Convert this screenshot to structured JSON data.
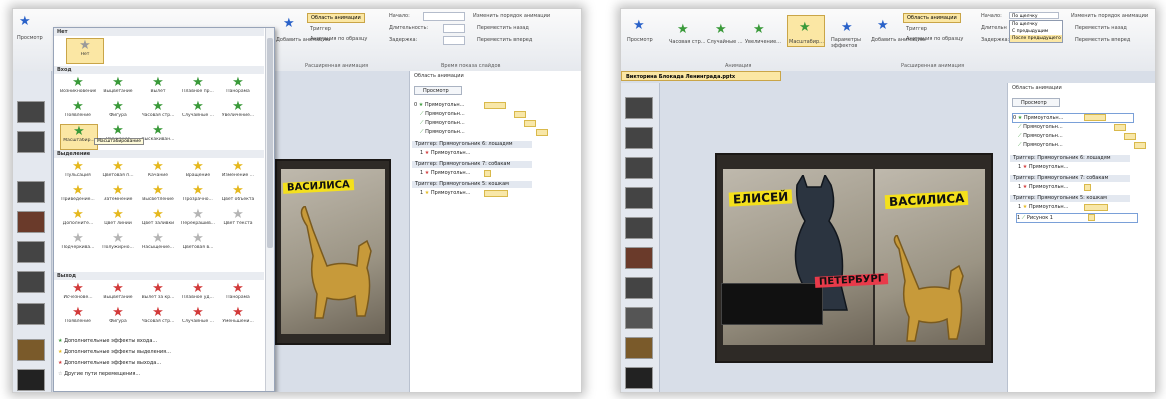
{
  "left": {
    "ribbon": {
      "anim_pane_btn": "Область анимации",
      "trigger_btn": "Триггер",
      "anim_painter": "Анимация по образцу",
      "group_ext": "Расширенная анимация",
      "start_label": "Начало:",
      "duration_label": "Длительность:",
      "delay_label": "Задержка:",
      "reorder_title": "Изменить порядок анимации",
      "move_back": "Переместить назад",
      "move_forward": "Переместить вперед",
      "timing_group": "Время показа слайдов",
      "add_anim": "Добавить анимацию",
      "preview": "Просмотр"
    },
    "gallery": {
      "none_section": "Нет",
      "none_item": "Нет",
      "entrance_section": "Вход",
      "entrance_items": [
        "Возникновение",
        "Выцветание",
        "Вылет",
        "Плавное пр...",
        "Панорама",
        "Появление",
        "Фигура",
        "Часовая стр...",
        "Случайные ...",
        "Увеличение...",
        "Масштабир...",
        "Вращение",
        "Выскакиван..."
      ],
      "tooltip": "Масштабирование",
      "emphasis_section": "Выделение",
      "emphasis_items": [
        "Пульсация",
        "Цветовая п...",
        "Качание",
        "Вращение",
        "Изменение ...",
        "Приведение...",
        "Затемнение",
        "Высветление",
        "Прозрачно...",
        "Цвет объекта",
        "Дополнитe...",
        "Цвет линии",
        "Цвет заливки",
        "Перекрашив...",
        "Цвет текста",
        "Подчеркива...",
        "Полужирно...",
        "Насыщение...",
        "Цветовая в..."
      ],
      "exit_section": "Выход",
      "exit_items": [
        "Исчезнове...",
        "Выцветание",
        "Вылет за кр...",
        "Плавное уд...",
        "Панорама",
        "Появление",
        "Фигура",
        "Часовая стр...",
        "Случайные ...",
        "Уменьшени..."
      ],
      "more": [
        "Дополнительные эффекты входа...",
        "Дополнительные эффекты выделения...",
        "Дополнительные эффекты выхода...",
        "Другие пути перемещения..."
      ]
    },
    "pane": {
      "title": "Область анимации",
      "preview": "Просмотр",
      "rows": [
        {
          "num": "0",
          "name": "Прямоугольн..."
        },
        {
          "num": "",
          "name": "Прямоугольн..."
        },
        {
          "num": "",
          "name": "Прямоугольн..."
        },
        {
          "num": "",
          "name": "Прямоугольн..."
        }
      ],
      "triggers": [
        {
          "label": "Триггер: Прямоугольник 6: лошадям",
          "row": "Прямоугольн..."
        },
        {
          "label": "Триггер: Прямоугольник 7: собакам",
          "row": "Прямоугольн..."
        },
        {
          "label": "Триггер: Прямоугольник 5: кошкам",
          "row": "Прямоугольн..."
        }
      ]
    },
    "slide": {
      "banner": "ВАСИЛИСА"
    }
  },
  "right": {
    "file_tab": "Викторина Блокада Ленинграда.pptx",
    "ribbon": {
      "preview": "Просмотр",
      "effects": [
        "Часовая стр...",
        "Случайные ...",
        "Увеличение...",
        "Масштабир..."
      ],
      "effect_params": "Параметры эффектов",
      "add_anim": "Добавить анимацию",
      "anim_pane_btn": "Область анимации",
      "trigger_btn": "Триггер",
      "painter": "Анимация по образцу",
      "group_anim": "Анимация",
      "group_ext": "Расширенная анимация",
      "start_label": "Начало:",
      "start_value": "По щелчку",
      "duration_label": "Длительн",
      "delay_label": "Задержка:",
      "dd_options": [
        "По щелчку",
        "С предыдущим",
        "После предыдущего"
      ],
      "reorder_title": "Изменить порядок анимации",
      "move_back": "Переместить назад",
      "move_forward": "Переместить вперед"
    },
    "pane": {
      "title": "Область анимации",
      "preview": "Просмотр",
      "rows": [
        {
          "num": "0",
          "name": "Прямоугольн..."
        },
        {
          "num": "",
          "name": "Прямоугольн..."
        },
        {
          "num": "",
          "name": "Прямоугольн..."
        },
        {
          "num": "",
          "name": "Прямоугольн..."
        }
      ],
      "triggers": [
        {
          "label": "Триггер: Прямоугольник 6: лошадям",
          "row": "Прямоугольн..."
        },
        {
          "label": "Триггер: Прямоугольник 7: собакам",
          "row": "Прямоугольн..."
        },
        {
          "label": "Триггер: Прямоугольник 5: кошкам",
          "row": "Прямоугольн..."
        }
      ],
      "extra_row": "Рисунок 1"
    },
    "slide": {
      "banner_left": "ЕЛИСЕЙ",
      "banner_right": "ВАСИЛИСА",
      "banner_red": "ПЕТЕРБУРГ"
    }
  },
  "colors": {
    "accent": "#f4e01c",
    "selected": "#fbe7a4",
    "star_green": "#3a9a3a",
    "star_yellow": "#e5b81e",
    "star_red": "#d23a3a"
  }
}
